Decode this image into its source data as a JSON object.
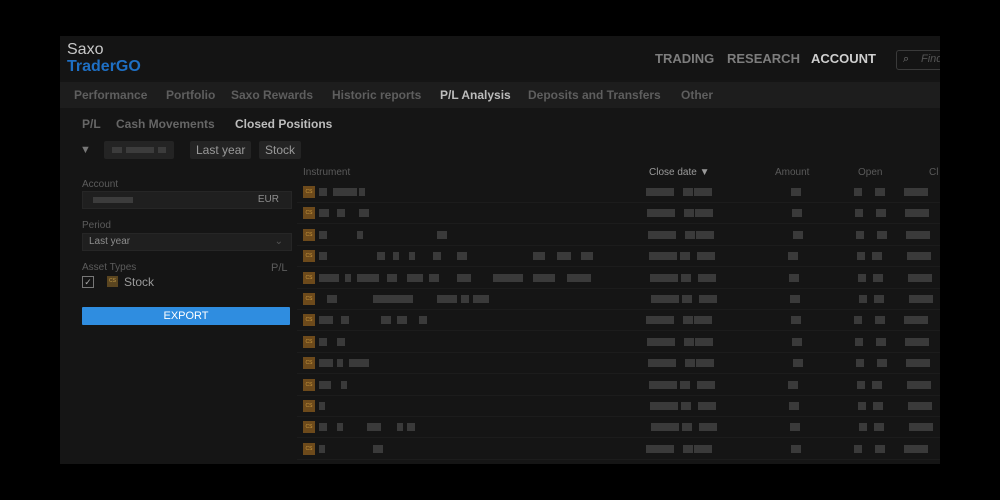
{
  "app": {
    "name_top": "Saxo",
    "name_bottom": "TraderGO"
  },
  "top_nav": [
    {
      "label": "TRADING",
      "active": false
    },
    {
      "label": "RESEARCH",
      "active": false
    },
    {
      "label": "ACCOUNT",
      "active": true
    }
  ],
  "search": {
    "placeholder": "Find"
  },
  "sub_nav": [
    {
      "label": "Performance",
      "active": false
    },
    {
      "label": "Portfolio",
      "active": false
    },
    {
      "label": "Saxo Rewards",
      "active": false
    },
    {
      "label": "Historic reports",
      "active": false
    },
    {
      "label": "P/L Analysis",
      "active": true
    },
    {
      "label": "Deposits and Transfers",
      "active": false
    },
    {
      "label": "Other",
      "active": false
    }
  ],
  "tabs": [
    {
      "label": "P/L",
      "active": false
    },
    {
      "label": "Cash Movements",
      "active": false
    },
    {
      "label": "Closed Positions",
      "active": true
    }
  ],
  "filters": {
    "period_chip": "Last year",
    "asset_chip": "Stock"
  },
  "side_panel": {
    "account_label": "Account",
    "account_currency": "EUR",
    "period_label": "Period",
    "period_value": "Last year",
    "asset_types_label": "Asset Types",
    "pl_label": "P/L",
    "stock_checkbox_label": "Stock",
    "stock_icon_text": "CS",
    "export_label": "EXPORT"
  },
  "grid": {
    "headers": {
      "instrument": "Instrument",
      "close_date": "Close date ▼",
      "amount": "Amount",
      "open": "Open",
      "close": "Cl"
    },
    "row_icon_text": "CS",
    "row_count": 13
  },
  "colors": {
    "accent": "#2f8de0",
    "brand": "#1e6fc4",
    "stock_icon": "#6d4a1b"
  }
}
